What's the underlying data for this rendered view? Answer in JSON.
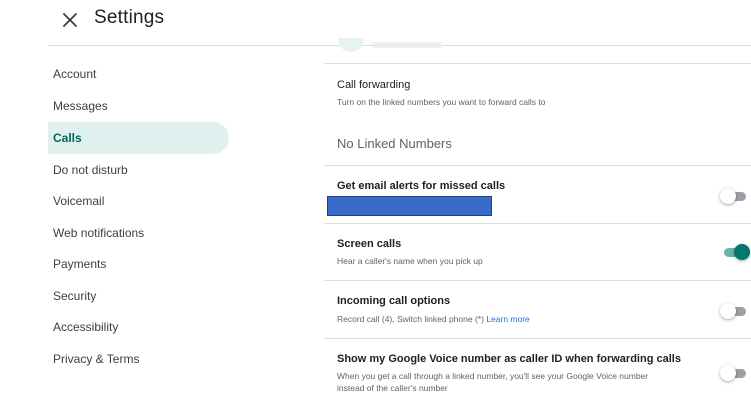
{
  "header": {
    "title": "Settings",
    "close_icon": "close-icon"
  },
  "sidebar": {
    "items": [
      {
        "label": "Account"
      },
      {
        "label": "Messages"
      },
      {
        "label": "Calls"
      },
      {
        "label": "Do not disturb"
      },
      {
        "label": "Voicemail"
      },
      {
        "label": "Web notifications"
      },
      {
        "label": "Payments"
      },
      {
        "label": "Security"
      },
      {
        "label": "Accessibility"
      },
      {
        "label": "Privacy & Terms"
      }
    ],
    "active": "Calls"
  },
  "main": {
    "call_forwarding": {
      "title": "Call forwarding",
      "subtitle": "Turn on the linked numbers you want to forward calls to",
      "empty_text": "No Linked Numbers"
    },
    "email_alerts": {
      "title": "Get email alerts for missed calls",
      "toggle_on": false
    },
    "screen_calls": {
      "title": "Screen calls",
      "subtitle": "Hear a caller's name when you pick up",
      "toggle_on": true
    },
    "incoming_options": {
      "title": "Incoming call options",
      "subtitle": "Record call (4), Switch linked phone (*)",
      "link": "Learn more",
      "toggle_on": false
    },
    "caller_id": {
      "title": "Show my Google Voice number as caller ID when forwarding calls",
      "subtitle_line1": "When you get a call through a linked number, you'll see your Google Voice number",
      "subtitle_line2": "instead of the caller's number",
      "toggle_on": false
    }
  },
  "colors": {
    "accent": "#00796b",
    "active_bg": "#e0f0ee",
    "link": "#1a73e8",
    "redaction": "#3b6bc9"
  }
}
